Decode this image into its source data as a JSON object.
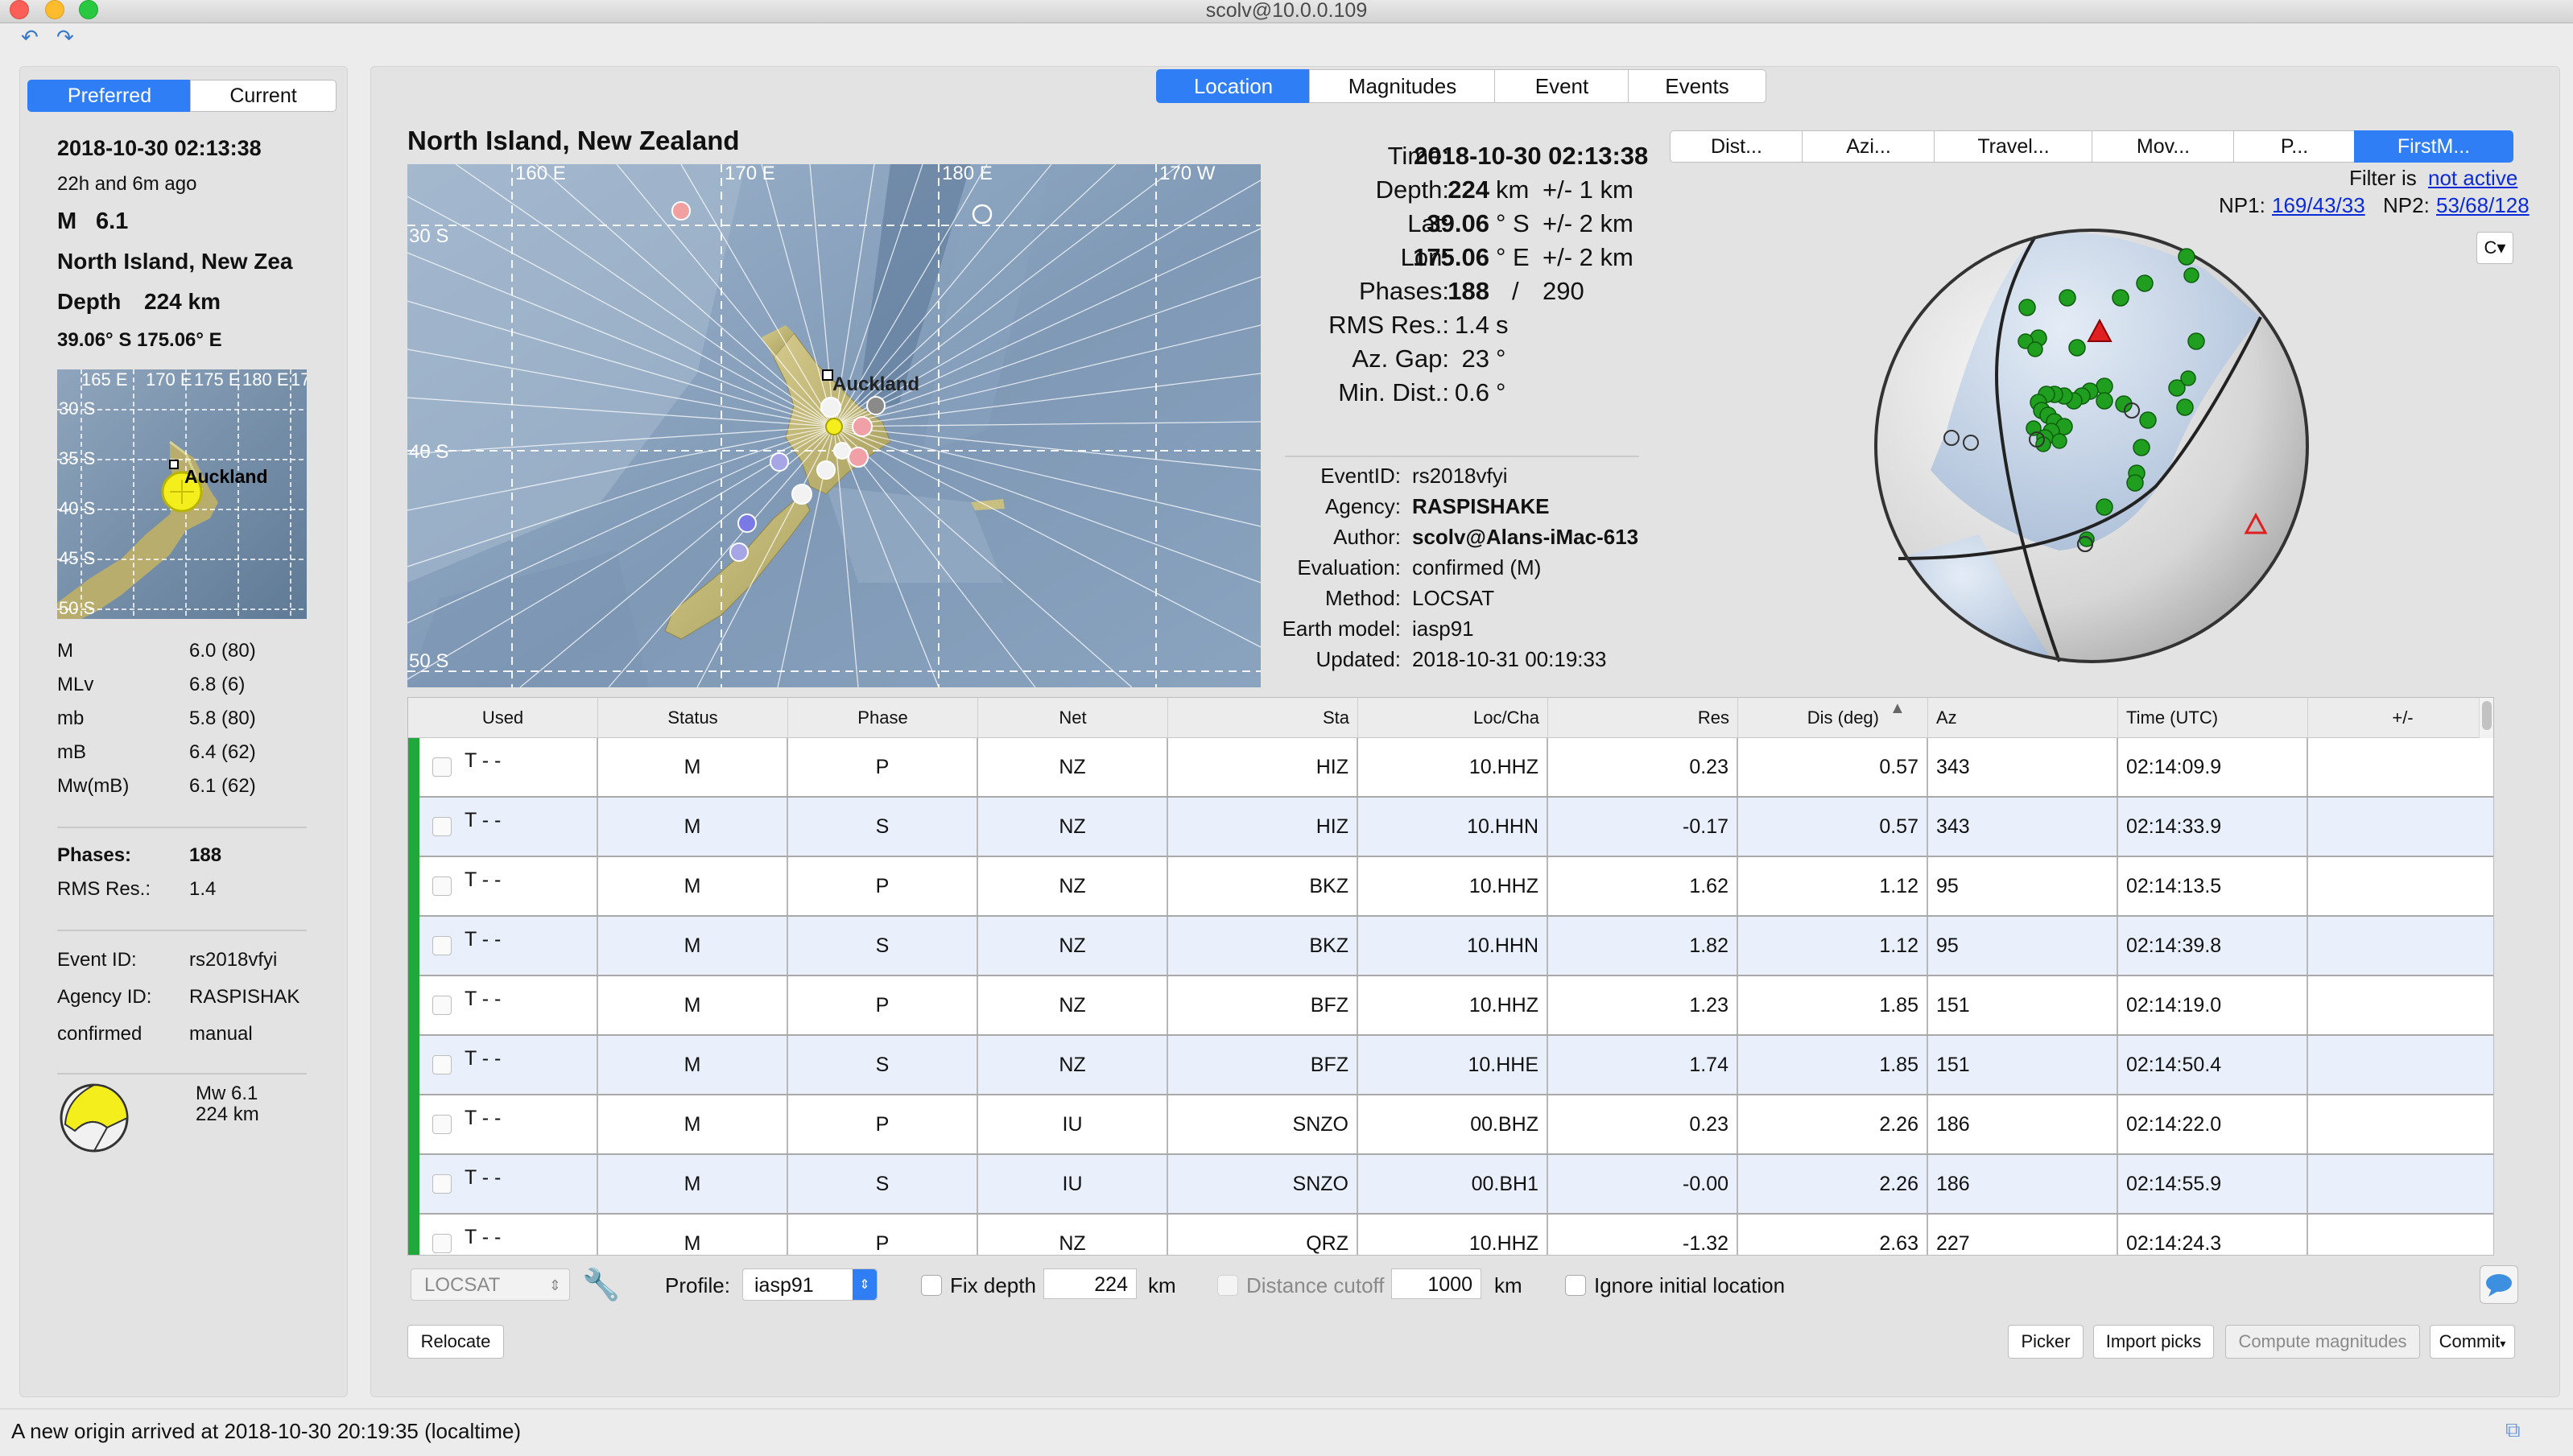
{
  "window": {
    "title": "scolv@10.0.0.109"
  },
  "left": {
    "tabs": [
      "Preferred",
      "Current"
    ],
    "time": "2018-10-30 02:13:38",
    "ago": "22h and 6m ago",
    "mag_label": "M",
    "mag_value": "6.1",
    "region": "North Island, New Zea",
    "depth_label": "Depth",
    "depth_value": "224 km",
    "coords": "39.06° S   175.06° E",
    "minimap": {
      "labels": [
        "165 E",
        "170 E",
        "175 E",
        "180 E",
        "17",
        "30 S",
        "35 S",
        "40 S",
        "45 S",
        "50 S"
      ],
      "city": "Auckland"
    },
    "magnitudes": [
      {
        "name": "M",
        "value": "6.0 (80)"
      },
      {
        "name": "MLv",
        "value": "6.8 (6)"
      },
      {
        "name": "mb",
        "value": "5.8 (80)"
      },
      {
        "name": "mB",
        "value": "6.4 (62)"
      },
      {
        "name": "Mw(mB)",
        "value": "6.1 (62)"
      }
    ],
    "phases_label": "Phases:",
    "phases_value": "188",
    "rms_label": "RMS Res.:",
    "rms_value": "1.4",
    "event_id_label": "Event ID:",
    "event_id_value": "rs2018vfyi",
    "agency_label": "Agency ID:",
    "agency_value": "RASPISHAK",
    "status_label": "confirmed",
    "status_value": "manual",
    "fm_mag": "Mw 6.1",
    "fm_depth": "224 km"
  },
  "main_tabs": [
    "Location",
    "Magnitudes",
    "Event",
    "Events"
  ],
  "map": {
    "title": "North Island, New Zealand",
    "lon_labels": [
      "160 E",
      "170 E",
      "180 E",
      "170 W"
    ],
    "lat_labels": [
      "30 S",
      "40 S",
      "50 S"
    ],
    "city": "Auckland"
  },
  "origin": {
    "time_label": "Time:",
    "time_value": "2018-10-30 02:13:38",
    "depth_label": "Depth:",
    "depth_value": "224",
    "depth_unit": "km",
    "depth_err": "+/-  1  km",
    "lat_label": "Lat:",
    "lat_value": "39.06",
    "lat_unit": "° S",
    "lat_err": "+/-  2  km",
    "lon_label": "Lon:",
    "lon_value": "175.06",
    "lon_unit": "° E",
    "lon_err": "+/-  2  km",
    "phases_label": "Phases:",
    "phases_value": "188",
    "phases_sep": "/",
    "phases_total": "290",
    "rms_label": "RMS Res.:",
    "rms_value": "1.4",
    "rms_unit": "s",
    "azgap_label": "Az. Gap:",
    "azgap_value": "23",
    "azgap_unit": "°",
    "mindist_label": "Min. Dist.:",
    "mindist_value": "0.6",
    "mindist_unit": "°",
    "eventid_label": "EventID:",
    "eventid_value": "rs2018vfyi",
    "agency_label": "Agency:",
    "agency_value": "RASPISHAKE",
    "author_label": "Author:",
    "author_value": "scolv@Alans-iMac-613",
    "evaluation_label": "Evaluation:",
    "evaluation_value": "confirmed (M)",
    "method_label": "Method:",
    "method_value": "LOCSAT",
    "earthmodel_label": "Earth model:",
    "earthmodel_value": "iasp91",
    "updated_label": "Updated:",
    "updated_value": "2018-10-31 00:19:33"
  },
  "plot_tabs": [
    "Dist...",
    "Azi...",
    "Travel...",
    "Mov...",
    "P...",
    "FirstM..."
  ],
  "filter": {
    "label": "Filter is",
    "value": "not active"
  },
  "np": {
    "np1_label": "NP1:",
    "np1_value": "169/43/33",
    "np2_label": "NP2:",
    "np2_value": "53/68/128"
  },
  "table": {
    "headers": [
      "Used",
      "Status",
      "Phase",
      "Net",
      "Sta",
      "Loc/Cha",
      "Res",
      "Dis (deg)",
      "Az",
      "Time (UTC)",
      "+/-"
    ],
    "sort_indicator": "▲",
    "rows": [
      {
        "used": "T  -  -",
        "status": "M",
        "phase": "P",
        "net": "NZ",
        "sta": "HIZ",
        "loccha": "10.HHZ",
        "res": "0.23",
        "dis": "0.57",
        "az": "343",
        "time": "02:14:09.9"
      },
      {
        "used": "T  -  -",
        "status": "M",
        "phase": "S",
        "net": "NZ",
        "sta": "HIZ",
        "loccha": "10.HHN",
        "res": "-0.17",
        "dis": "0.57",
        "az": "343",
        "time": "02:14:33.9"
      },
      {
        "used": "T  -  -",
        "status": "M",
        "phase": "P",
        "net": "NZ",
        "sta": "BKZ",
        "loccha": "10.HHZ",
        "res": "1.62",
        "dis": "1.12",
        "az": "95",
        "time": "02:14:13.5"
      },
      {
        "used": "T  -  -",
        "status": "M",
        "phase": "S",
        "net": "NZ",
        "sta": "BKZ",
        "loccha": "10.HHN",
        "res": "1.82",
        "dis": "1.12",
        "az": "95",
        "time": "02:14:39.8"
      },
      {
        "used": "T  -  -",
        "status": "M",
        "phase": "P",
        "net": "NZ",
        "sta": "BFZ",
        "loccha": "10.HHZ",
        "res": "1.23",
        "dis": "1.85",
        "az": "151",
        "time": "02:14:19.0"
      },
      {
        "used": "T  -  -",
        "status": "M",
        "phase": "S",
        "net": "NZ",
        "sta": "BFZ",
        "loccha": "10.HHE",
        "res": "1.74",
        "dis": "1.85",
        "az": "151",
        "time": "02:14:50.4"
      },
      {
        "used": "T  -  -",
        "status": "M",
        "phase": "P",
        "net": "IU",
        "sta": "SNZO",
        "loccha": "00.BHZ",
        "res": "0.23",
        "dis": "2.26",
        "az": "186",
        "time": "02:14:22.0"
      },
      {
        "used": "T  -  -",
        "status": "M",
        "phase": "S",
        "net": "IU",
        "sta": "SNZO",
        "loccha": "00.BH1",
        "res": "-0.00",
        "dis": "2.26",
        "az": "186",
        "time": "02:14:55.9"
      },
      {
        "used": "T  -  -",
        "status": "M",
        "phase": "P",
        "net": "NZ",
        "sta": "QRZ",
        "loccha": "10.HHZ",
        "res": "-1.32",
        "dis": "2.63",
        "az": "227",
        "time": "02:14:24.3"
      }
    ]
  },
  "controls": {
    "locator": "LOCSAT",
    "profile_label": "Profile:",
    "profile_value": "iasp91",
    "fix_depth_label": "Fix depth",
    "fix_depth_value": "224",
    "fix_depth_unit": "km",
    "distance_cutoff_label": "Distance cutoff",
    "distance_cutoff_value": "1000",
    "distance_cutoff_unit": "km",
    "ignore_label": "Ignore initial location",
    "relocate": "Relocate",
    "picker": "Picker",
    "import_picks": "Import picks",
    "compute_magnitudes": "Compute magnitudes",
    "commit": "Commit"
  },
  "status_message": "A new origin arrived at 2018-10-30 20:19:35 (localtime)",
  "colors": {
    "accent": "#2f7ef6",
    "used": "#21a83a",
    "station_green": "#1f9e1f",
    "row_alt": "#e9f0fb"
  },
  "icons": [
    "close-icon",
    "minimize-icon",
    "zoom-icon",
    "undo-icon",
    "redo-icon",
    "wrench-icon",
    "chat-icon",
    "settings-icon"
  ]
}
